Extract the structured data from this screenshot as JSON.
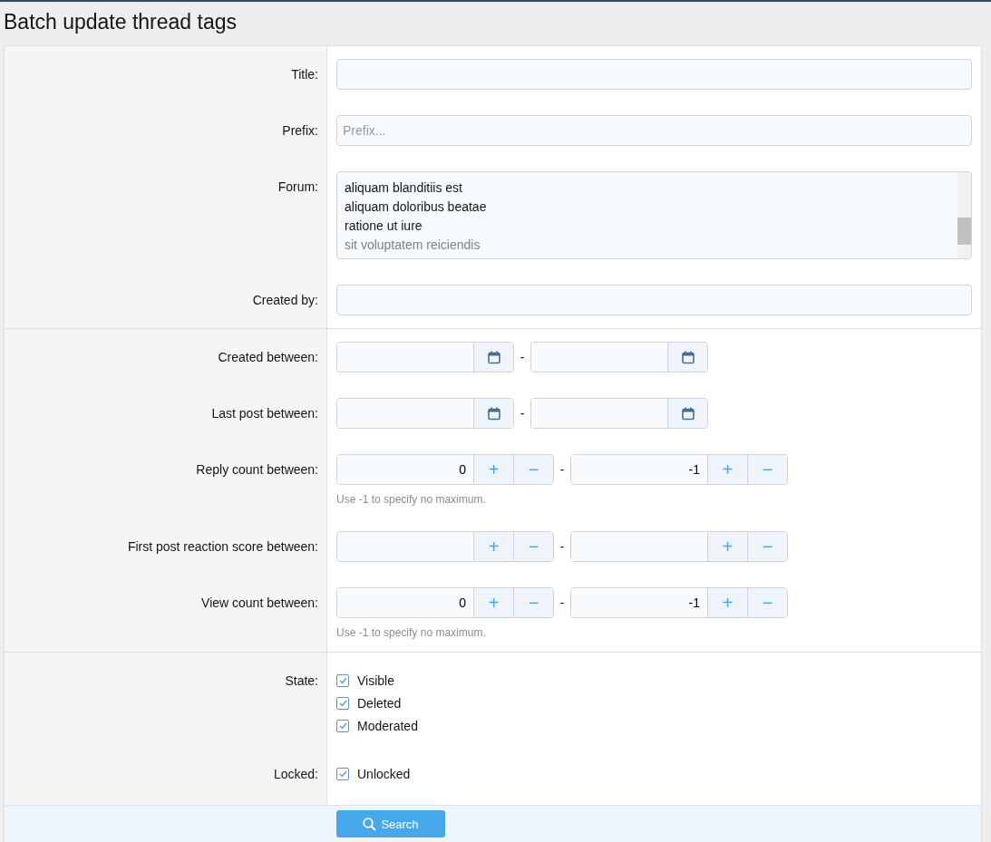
{
  "page_title": "Batch update thread tags",
  "rows": [
    {
      "kind": "text",
      "label": "Title:",
      "value": ""
    },
    {
      "kind": "text",
      "label": "Prefix:",
      "placeholder": "Prefix..."
    },
    {
      "kind": "select_list",
      "label": "Forum:",
      "options": [
        {
          "text": "aliquam blanditiis est",
          "disabled": false
        },
        {
          "text": "aliquam doloribus beatae",
          "disabled": false
        },
        {
          "text": "ratione ut iure",
          "disabled": false
        },
        {
          "text": "sit voluptatem reiciendis",
          "disabled": true
        }
      ]
    },
    {
      "kind": "text",
      "label": "Created by:",
      "value": "",
      "divider_after": true
    },
    {
      "kind": "date_range",
      "label": "Created between:",
      "separator": "-"
    },
    {
      "kind": "date_range",
      "label": "Last post between:",
      "separator": "-"
    },
    {
      "kind": "number_range",
      "label": "Reply count between:",
      "from": "0",
      "to": "-1",
      "separator": "-",
      "plus": "+",
      "minus": "−",
      "hint": "Use -1 to specify no maximum."
    },
    {
      "kind": "number_range",
      "label": "First post reaction score between:",
      "from": "",
      "to": "",
      "separator": "-",
      "plus": "+",
      "minus": "−"
    },
    {
      "kind": "number_range",
      "label": "View count between:",
      "from": "0",
      "to": "-1",
      "separator": "-",
      "plus": "+",
      "minus": "−",
      "hint": "Use -1 to specify no maximum.",
      "divider_after": true
    },
    {
      "kind": "checkboxes",
      "label": "State:",
      "items": [
        {
          "text": "Visible",
          "checked": true
        },
        {
          "text": "Deleted",
          "checked": true
        },
        {
          "text": "Moderated",
          "checked": true
        }
      ]
    },
    {
      "kind": "checkboxes",
      "label": "Locked:",
      "items": [
        {
          "text": "Unlocked",
          "checked": true
        }
      ]
    }
  ],
  "submit": {
    "label": "Search"
  }
}
